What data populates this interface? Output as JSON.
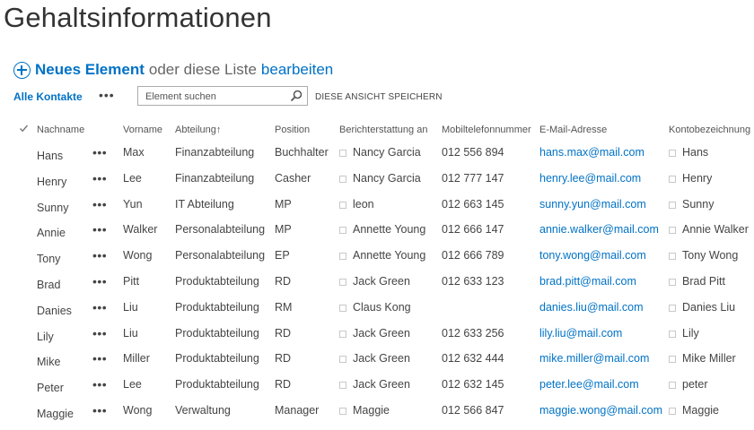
{
  "page": {
    "title": "Gehaltsinformationen"
  },
  "actions": {
    "new_item": "Neues Element",
    "or_text": "oder diese Liste",
    "edit": "bearbeiten"
  },
  "viewbar": {
    "view_name": "Alle Kontakte",
    "ellipsis": "•••",
    "search_placeholder": "Element suchen",
    "save_view": "DIESE ANSICHT SPEICHERN"
  },
  "table": {
    "headers": {
      "nachname": "Nachname",
      "vorname": "Vorname",
      "abteilung": "Abteilung",
      "sort_arrow": "↑",
      "position": "Position",
      "berichterstattung": "Berichterstattung an",
      "mobil": "Mobiltelefonnummer",
      "email": "E-Mail-Adresse",
      "konto": "Kontobezeichnung"
    },
    "rows": [
      {
        "nachname": "Hans",
        "dots": "•••",
        "vorname": "Max",
        "abteilung": "Finanzabteilung",
        "position": "Buchhalter",
        "manager": "Nancy Garcia",
        "mobil": "012 556 894",
        "email": "hans.max@mail.com",
        "konto": "Hans"
      },
      {
        "nachname": "Henry",
        "dots": "•••",
        "vorname": "Lee",
        "abteilung": "Finanzabteilung",
        "position": "Casher",
        "manager": "Nancy Garcia",
        "mobil": "012 777 147",
        "email": "henry.lee@mail.com",
        "konto": "Henry"
      },
      {
        "nachname": "Sunny",
        "dots": "•••",
        "vorname": "Yun",
        "abteilung": "IT Abteilung",
        "position": "MP",
        "manager": "leon",
        "mobil": "012 663 145",
        "email": "sunny.yun@mail.com",
        "konto": "Sunny"
      },
      {
        "nachname": "Annie",
        "dots": "•••",
        "vorname": "Walker",
        "abteilung": "Personalabteilung",
        "position": "MP",
        "manager": "Annette Young",
        "mobil": "012 666 147",
        "email": "annie.walker@mail.com",
        "konto": "Annie Walker"
      },
      {
        "nachname": "Tony",
        "dots": "•••",
        "vorname": "Wong",
        "abteilung": "Personalabteilung",
        "position": "EP",
        "manager": "Annette Young",
        "mobil": "012 666 789",
        "email": "tony.wong@mail.com",
        "konto": "Tony Wong"
      },
      {
        "nachname": "Brad",
        "dots": "•••",
        "vorname": "Pitt",
        "abteilung": "Produktabteilung",
        "position": "RD",
        "manager": "Jack Green",
        "mobil": "012 633 123",
        "email": "brad.pitt@mail.com",
        "konto": "Brad Pitt"
      },
      {
        "nachname": "Danies",
        "dots": "•••",
        "vorname": "Liu",
        "abteilung": "Produktabteilung",
        "position": "RM",
        "manager": "Claus Kong",
        "mobil": "",
        "email": "danies.liu@mail.com",
        "konto": "Danies Liu"
      },
      {
        "nachname": "Lily",
        "dots": "•••",
        "vorname": "Liu",
        "abteilung": "Produktabteilung",
        "position": "RD",
        "manager": "Jack Green",
        "mobil": "012 633 256",
        "email": "lily.liu@mail.com",
        "konto": "Lily"
      },
      {
        "nachname": "Mike",
        "dots": "•••",
        "vorname": "Miller",
        "abteilung": "Produktabteilung",
        "position": "RD",
        "manager": "Jack Green",
        "mobil": "012 632 444",
        "email": "mike.miller@mail.com",
        "konto": "Mike Miller"
      },
      {
        "nachname": "Peter",
        "dots": "•••",
        "vorname": "Lee",
        "abteilung": "Produktabteilung",
        "position": "RD",
        "manager": "Jack Green",
        "mobil": "012 632 145",
        "email": "peter.lee@mail.com",
        "konto": "peter"
      },
      {
        "nachname": "Maggie",
        "dots": "•••",
        "vorname": "Wong",
        "abteilung": "Verwaltung",
        "position": "Manager",
        "manager": "Maggie",
        "mobil": "012 566 847",
        "email": "maggie.wong@mail.com",
        "konto": "Maggie"
      }
    ]
  },
  "colors": {
    "accent": "#0072c6",
    "text": "#444444",
    "title": "#333333"
  },
  "icons": {
    "new": "plus-circle-icon",
    "search": "search-icon",
    "select_all": "checkmark-icon"
  }
}
